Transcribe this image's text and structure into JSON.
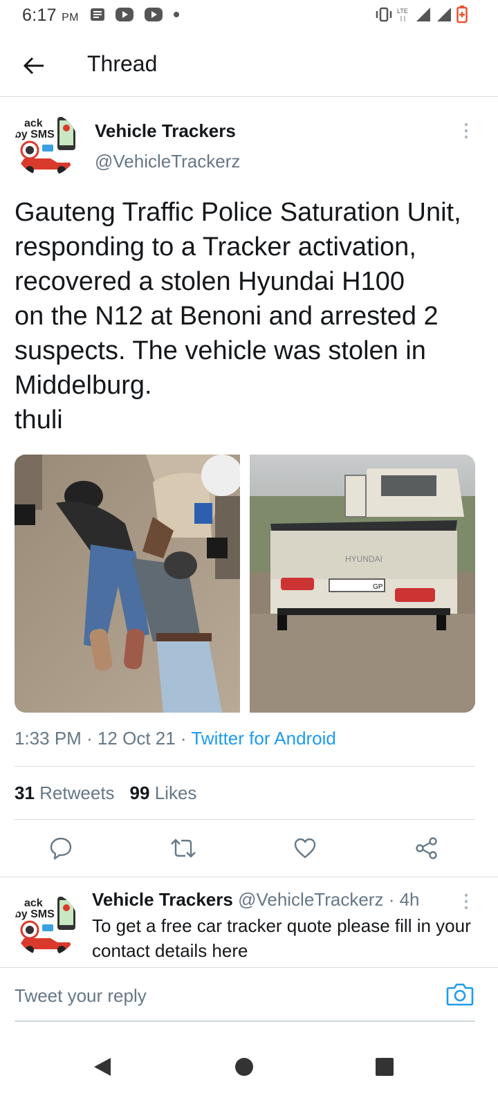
{
  "status_bar": {
    "time": "6:17",
    "ampm": "PM",
    "network": "LTE"
  },
  "header": {
    "title": "Thread"
  },
  "tweet": {
    "author_name": "Vehicle Trackers",
    "author_handle": "@VehicleTrackerz",
    "text": "Gauteng Traffic Police Saturation Unit, responding to a Tracker activation, recovered a stolen Hyundai H100\non the N12 at Benoni and arrested 2 suspects. The vehicle was stolen in Middelburg.\nthuli",
    "time": "1:33 PM",
    "date": "12 Oct 21",
    "source": "Twitter for Android",
    "retweets_count": "31",
    "retweets_label": "Retweets",
    "likes_count": "99",
    "likes_label": "Likes",
    "truck_brand": "HYUNDAI",
    "plate_suffix": "GP",
    "avatar_text_top": "ack",
    "avatar_text_bottom": "by SMS"
  },
  "reply": {
    "author_name": "Vehicle Trackers",
    "author_handle": "@VehicleTrackerz",
    "separator": "·",
    "age": "4h",
    "text": "To get a free car tracker quote please fill in your contact details here"
  },
  "compose": {
    "placeholder": "Tweet your reply"
  },
  "colors": {
    "accent": "#1d9bf0",
    "secondary_text": "#657786",
    "primary_text": "#14171a"
  },
  "icons": {
    "back": "arrow-left-icon",
    "more": "vertical-dots-icon",
    "reply": "speech-bubble-icon",
    "retweet": "retweet-icon",
    "like": "heart-icon",
    "share": "share-icon",
    "camera": "camera-icon"
  }
}
